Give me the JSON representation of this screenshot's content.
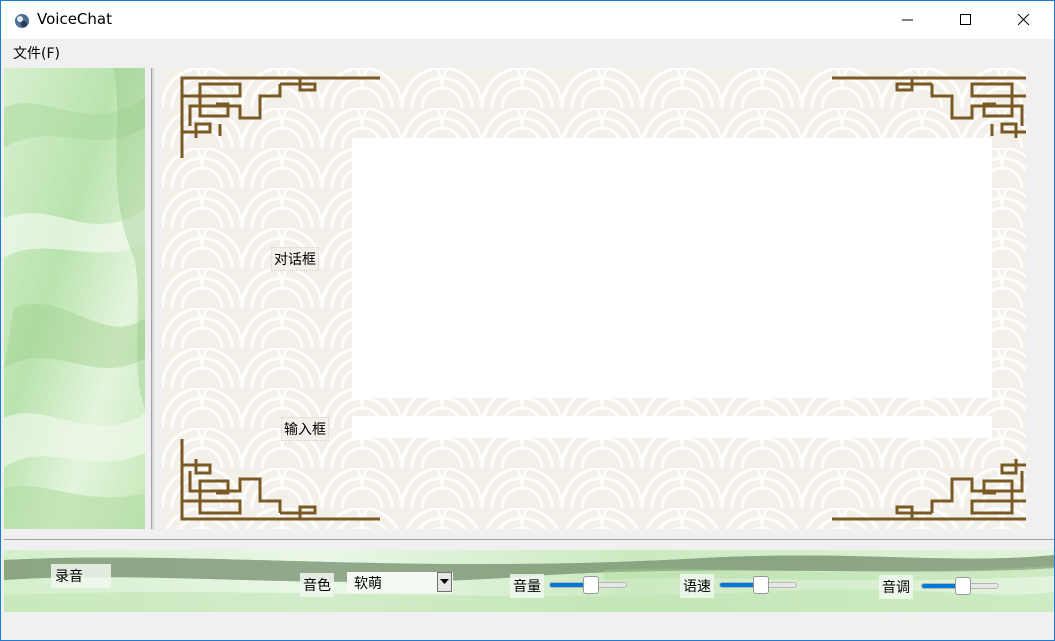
{
  "window": {
    "title": "VoiceChat"
  },
  "menu": {
    "file": "文件(F)"
  },
  "chat": {
    "dialog_label": "对话框",
    "input_label": "输入框",
    "dialog_text": "",
    "input_value": ""
  },
  "controls": {
    "record": "录音",
    "timbre_label": "音色",
    "timbre_value": "软萌",
    "volume_label": "音量",
    "volume_level": 0.55,
    "speed_label": "语速",
    "speed_level": 0.55,
    "pitch_label": "音调",
    "pitch_level": 0.55
  },
  "colors": {
    "accent": "#0078d7",
    "frame_gold": "#7a5a24",
    "window_border": "#1b7bd2"
  }
}
